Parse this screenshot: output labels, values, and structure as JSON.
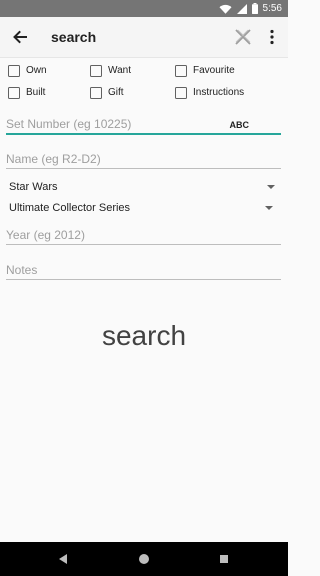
{
  "status_bar": {
    "time": "5:56",
    "icons": [
      "wifi-icon",
      "signal-icon",
      "battery-icon"
    ]
  },
  "app_bar": {
    "title": "search",
    "back_icon": "arrow-left-icon",
    "clear_icon": "close-icon",
    "menu_icon": "more-vert-icon"
  },
  "filters": {
    "own": "Own",
    "want": "Want",
    "favourite": "Favourite",
    "built": "Built",
    "gift": "Gift",
    "instructions": "Instructions"
  },
  "fields": {
    "set_number_placeholder": "Set Number (eg 10225)",
    "keyboard_mode": "ABC",
    "name_placeholder": "Name (eg R2-D2)",
    "theme_value": "Star Wars",
    "subtheme_value": "Ultimate Collector Series",
    "year_placeholder": "Year (eg 2012)",
    "notes_placeholder": "Notes"
  },
  "actions": {
    "search_label": "search"
  },
  "colors": {
    "accent": "#26a69a",
    "status_bar": "#757575",
    "nav_bar": "#000000",
    "background": "#fafafa"
  }
}
